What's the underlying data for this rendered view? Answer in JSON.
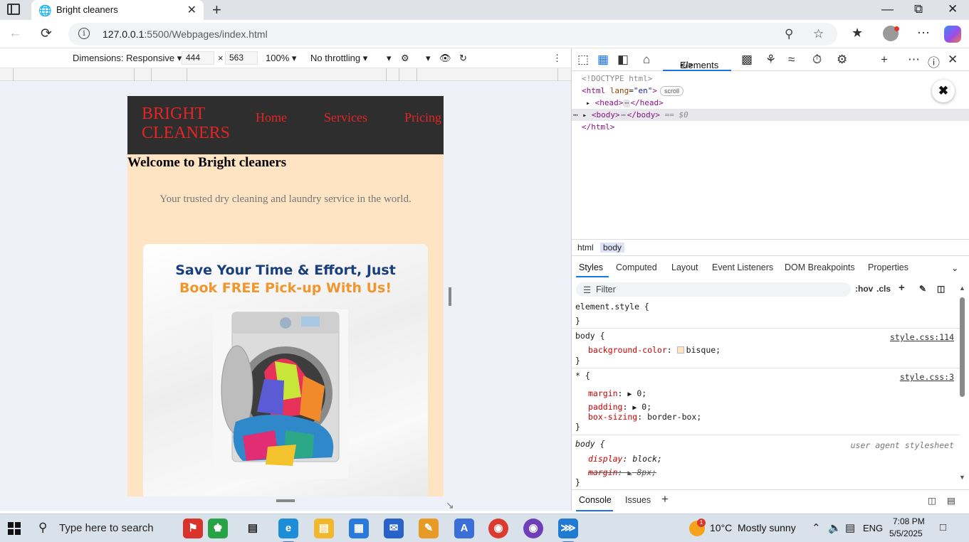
{
  "browser": {
    "tab_title": "Bright cleaners",
    "url_host": "127.0.0.1",
    "url_path": ":5500/Webpages/index.html"
  },
  "device_toolbar": {
    "dimensions_label": "Dimensions: Responsive",
    "width": "444",
    "height": "563",
    "zoom": "100%",
    "throttling": "No throttling"
  },
  "site": {
    "brand": "BRIGHT CLEANERS",
    "nav": [
      "Home",
      "Services",
      "Pricing"
    ],
    "welcome": "Welcome to Bright cleaners",
    "tagline": "Your trusted dry cleaning and laundry service in the world.",
    "promo_line1": "Save Your Time & Effort, Just",
    "promo_line2": "Book FREE Pick-up With Us!",
    "background_color": "#ffe4c4",
    "header_color": "#2e2e2e",
    "link_color": "#e52424"
  },
  "devtools": {
    "active_tab": "Elements",
    "dom": {
      "doctype": "<!DOCTYPE html>",
      "html_open": "<html",
      "lang_attr": "lang",
      "lang_value": "\"en\"",
      "scroll_badge": "scroll",
      "head": "<head>",
      "head_close": "</head>",
      "body": "<body>",
      "body_close": "</body>",
      "body_marker": "== $0",
      "html_close": "</html>"
    },
    "breadcrumbs": [
      "html",
      "body"
    ],
    "panel_tabs": [
      "Styles",
      "Computed",
      "Layout",
      "Event Listeners",
      "DOM Breakpoints",
      "Properties"
    ],
    "filter_placeholder": "Filter",
    "hov": ":hov",
    "cls": ".cls",
    "rules": {
      "element_style": "element.style {",
      "close": "}",
      "body_selector": "body {",
      "body_source": "style.css:114",
      "bg_prop": "background-color",
      "bg_value": "bisque;",
      "star_selector": "* {",
      "star_source": "style.css:3",
      "margin_prop": "margin",
      "margin_value": "0;",
      "padding_prop": "padding",
      "padding_value": "0;",
      "boxsizing_prop": "box-sizing",
      "boxsizing_value": "border-box;",
      "ua_selector": "body {",
      "ua_source": "user agent stylesheet",
      "display_prop": "display",
      "display_value": "block;",
      "ua_margin_prop": "margin",
      "ua_margin_value": "8px;"
    },
    "drawer_tabs": [
      "Console",
      "Issues"
    ]
  },
  "taskbar": {
    "search_placeholder": "Type here to search",
    "weather_temp": "10°C",
    "weather_desc": "Mostly sunny",
    "weather_badge": "1",
    "language": "ENG",
    "time": "7:08 PM",
    "date": "5/5/2025"
  }
}
